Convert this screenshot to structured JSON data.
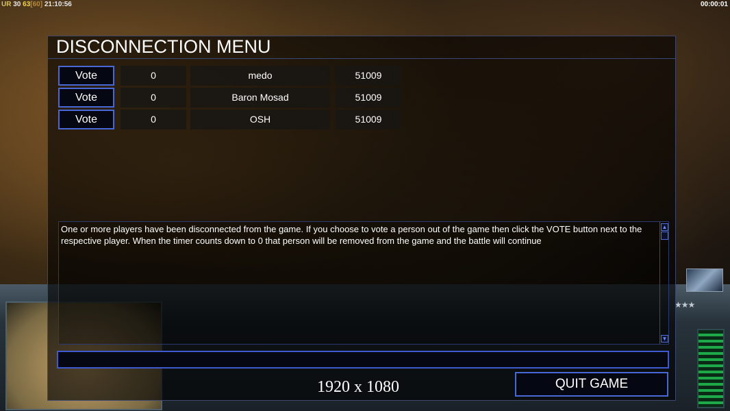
{
  "hud": {
    "top_left": {
      "prefix": "UR",
      "v1": "30",
      "v2": "63",
      "v3": "[60]",
      "clock": "21:10:56"
    },
    "top_right_timer": "00:00:01"
  },
  "dialog": {
    "title": "DISCONNECTION MENU",
    "players": [
      {
        "vote_label": "Vote",
        "count": "0",
        "name": "medo",
        "ping": "51009"
      },
      {
        "vote_label": "Vote",
        "count": "0",
        "name": "Baron Mosad",
        "ping": "51009"
      },
      {
        "vote_label": "Vote",
        "count": "0",
        "name": "OSH",
        "ping": "51009"
      }
    ],
    "message": "One or more players have been disconnected from the game. If you choose to vote a person out of the game then click the VOTE button next to the respective player. When the timer counts down to 0 that person will be removed from the game and the battle will continue",
    "quit_label": "QUIT GAME"
  },
  "resolution_label": "1920 x 1080",
  "colors": {
    "accent_border": "#4868d8"
  }
}
